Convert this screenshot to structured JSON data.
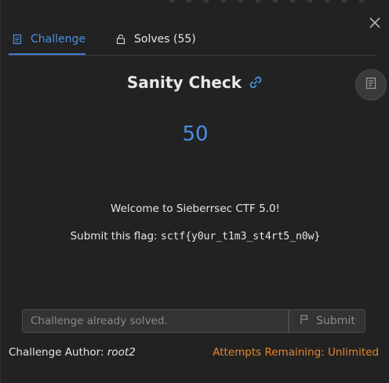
{
  "tabs": [
    {
      "label": "Challenge",
      "icon": "document-icon",
      "active": true
    },
    {
      "label": "Solves (55)",
      "icon": "lock-icon",
      "active": false
    }
  ],
  "challenge": {
    "name": "Sanity Check",
    "points": "50",
    "description_line1": "Welcome to Sieberrsec CTF 5.0!",
    "description_line2_prefix": "Submit this flag: ",
    "flag": "sctf{y0ur_t1m3_st4rt5_n0w}"
  },
  "answer": {
    "placeholder": "Challenge already solved.",
    "submit_label": "Submit"
  },
  "footer": {
    "author_label": "Challenge Author: ",
    "author_name": "root2",
    "attempts": "Attempts Remaining: Unlimited"
  },
  "colors": {
    "accent": "#4a90e2",
    "attempts": "#e8862a",
    "background": "#222222"
  }
}
